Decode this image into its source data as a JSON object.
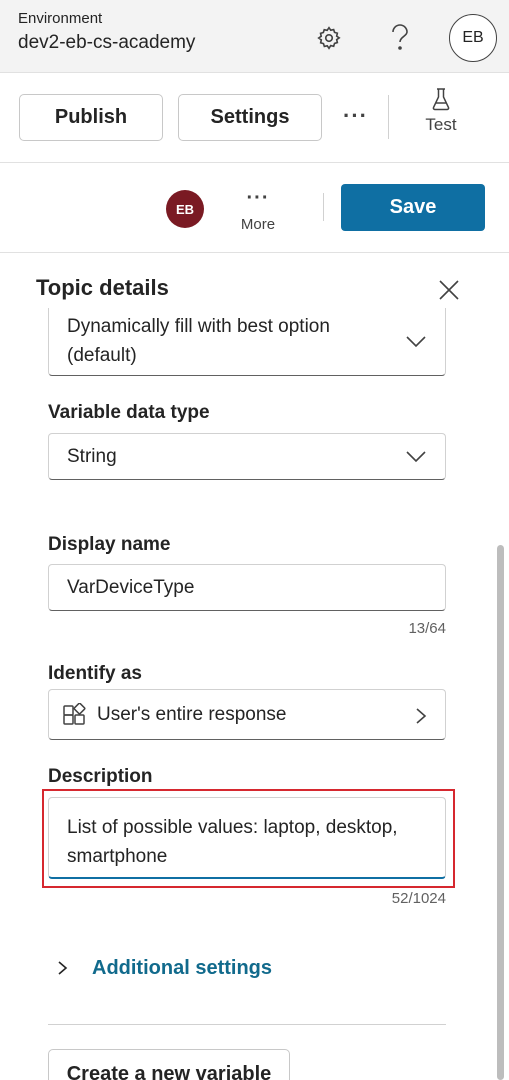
{
  "environment": {
    "label": "Environment",
    "name": "dev2-eb-cs-academy",
    "user_initials": "EB",
    "icons": [
      "settings-gear-icon",
      "help-question-icon"
    ]
  },
  "toolbar": {
    "publish_label": "Publish",
    "settings_label": "Settings",
    "more_glyph": "···",
    "test_label": "Test"
  },
  "editor_bar": {
    "user_initials": "EB",
    "more_glyph": "···",
    "more_label": "More",
    "save_label": "Save",
    "accent_color": "#0f6fa3",
    "avatar_color": "#7a1a23"
  },
  "topic_details": {
    "title": "Topic details",
    "fill_option": {
      "value": "Dynamically fill with best option (default)"
    },
    "variable_data_type": {
      "label": "Variable data type",
      "value": "String"
    },
    "display_name": {
      "label": "Display name",
      "value": "VarDeviceType",
      "counter": "13/64"
    },
    "identify_as": {
      "label": "Identify as",
      "value": "User's entire response"
    },
    "description": {
      "label": "Description",
      "value": "List of possible values: laptop, desktop, smartphone",
      "counter": "52/1024",
      "highlight_color": "#d6282f"
    },
    "additional_settings_label": "Additional settings",
    "create_variable_label": "Create a new variable"
  }
}
